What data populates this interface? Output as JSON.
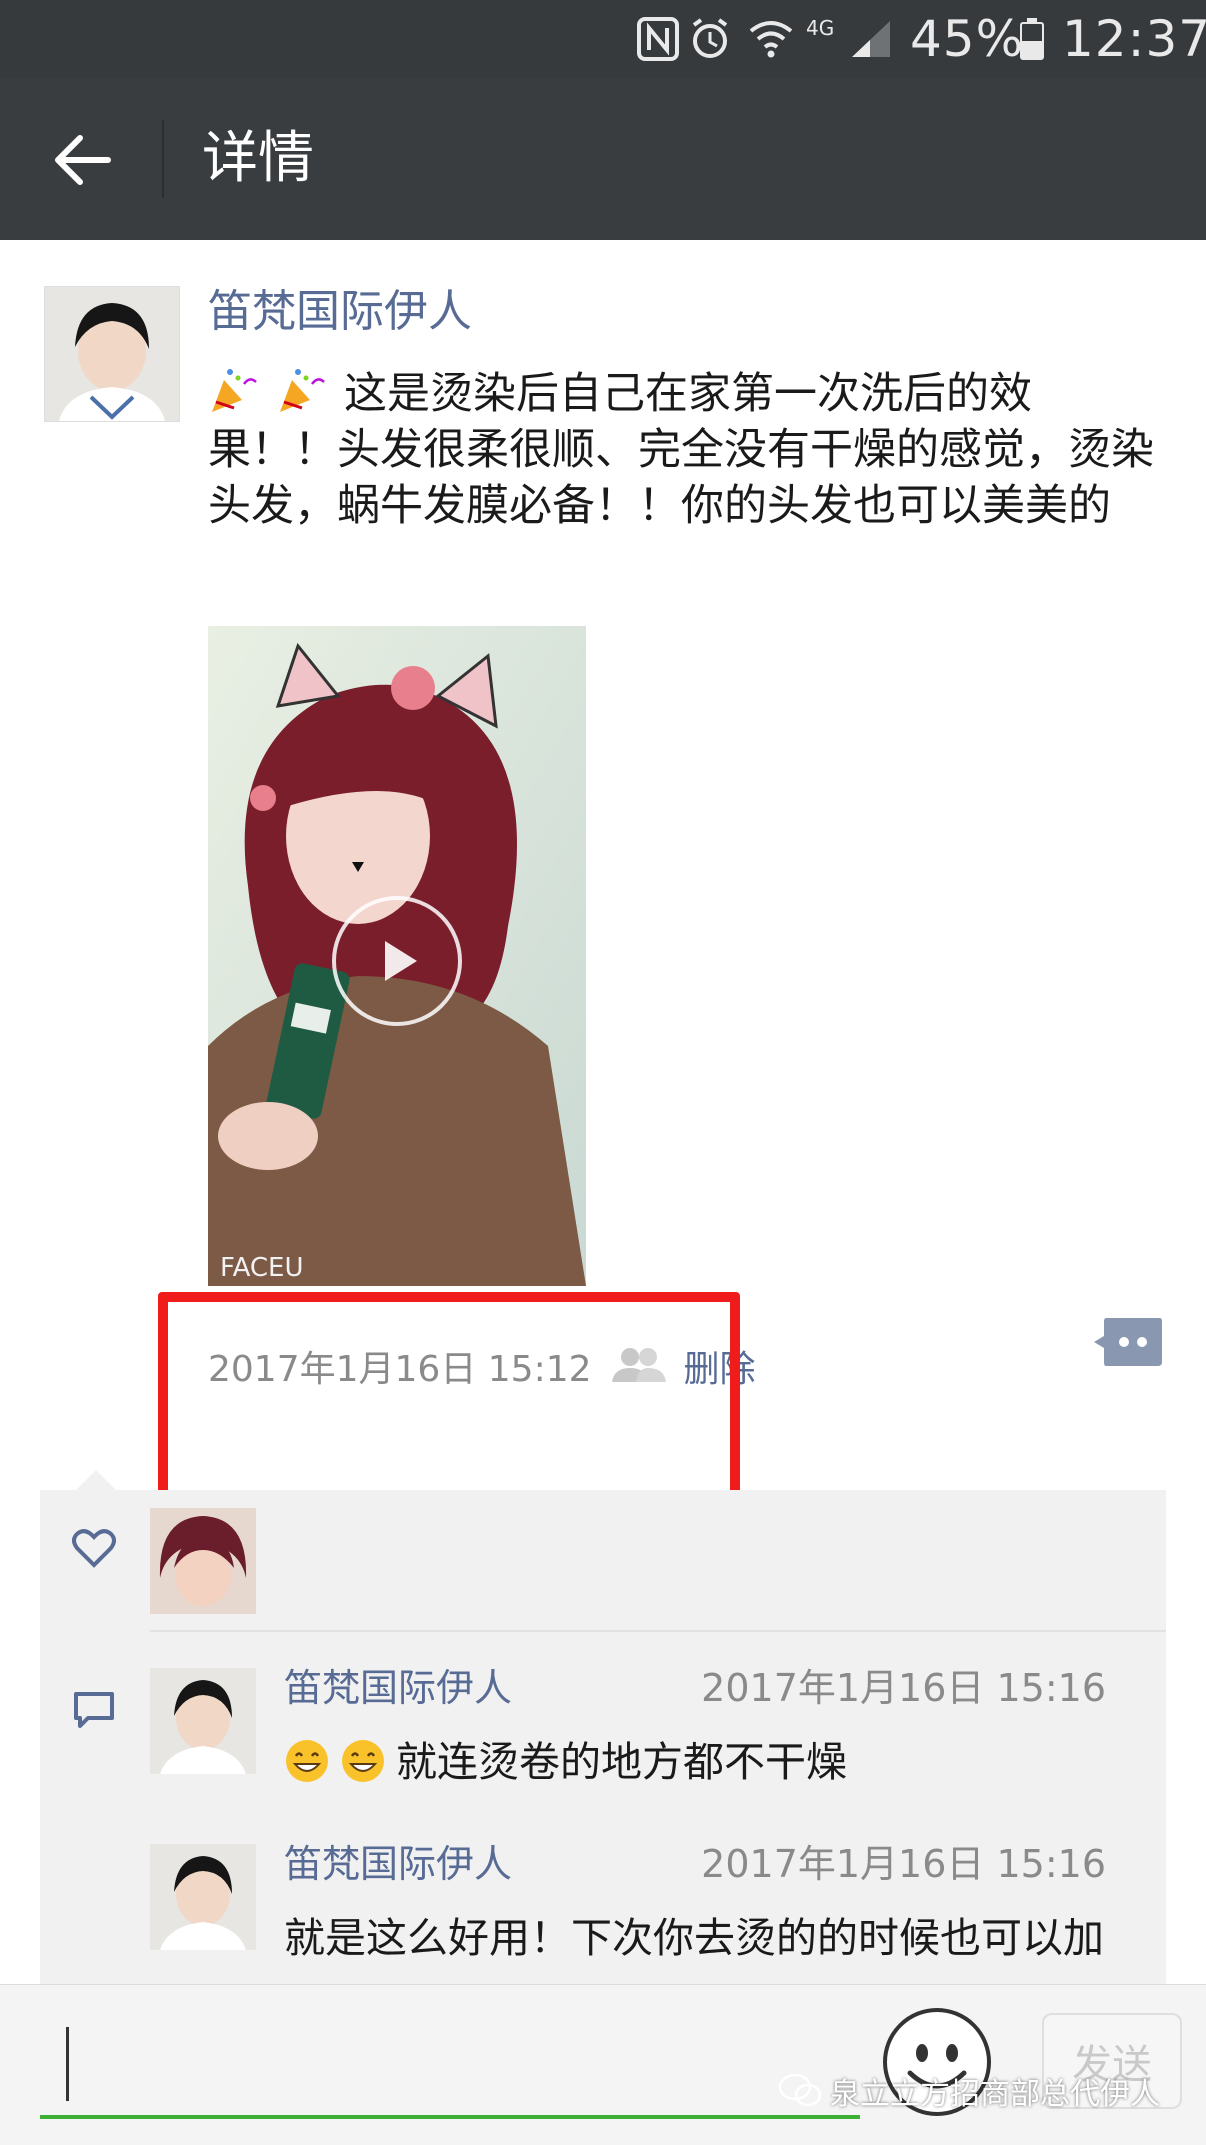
{
  "status_bar": {
    "battery": "45%",
    "time": "12:37",
    "network": "4G",
    "icons": [
      "nfc-icon",
      "alarm-icon",
      "wifi-icon",
      "signal-icon",
      "battery-icon"
    ]
  },
  "header": {
    "title": "详情",
    "back_icon": "back-arrow-icon"
  },
  "post": {
    "author": "笛梵国际伊人",
    "text": "这是烫染后自己在家第一次洗后的效果！！头发很柔很顺、完全没有干燥的感觉，烫染头发，蜗牛发膜必备！！你的头发也可以美美的",
    "timestamp": "2017年1月16日 15:12",
    "delete_label": "删除",
    "media": "video",
    "video_watermark": "FACEU"
  },
  "likes": {
    "icon": "heart-icon"
  },
  "comments": [
    {
      "author": "笛梵国际伊人",
      "time": "2017年1月16日 15:16",
      "text": "就连烫卷的地方都不干燥"
    },
    {
      "author": "笛梵国际伊人",
      "time": "2017年1月16日 15:16",
      "text": "就是这么好用！下次你去烫的的时候也可以加"
    }
  ],
  "composer": {
    "send_label": "发送",
    "watermark": "泉立立方招商部总代伊人"
  },
  "colors": {
    "link": "#576b95",
    "highlight": "#f01c1c",
    "input_accent": "#3cb034"
  }
}
